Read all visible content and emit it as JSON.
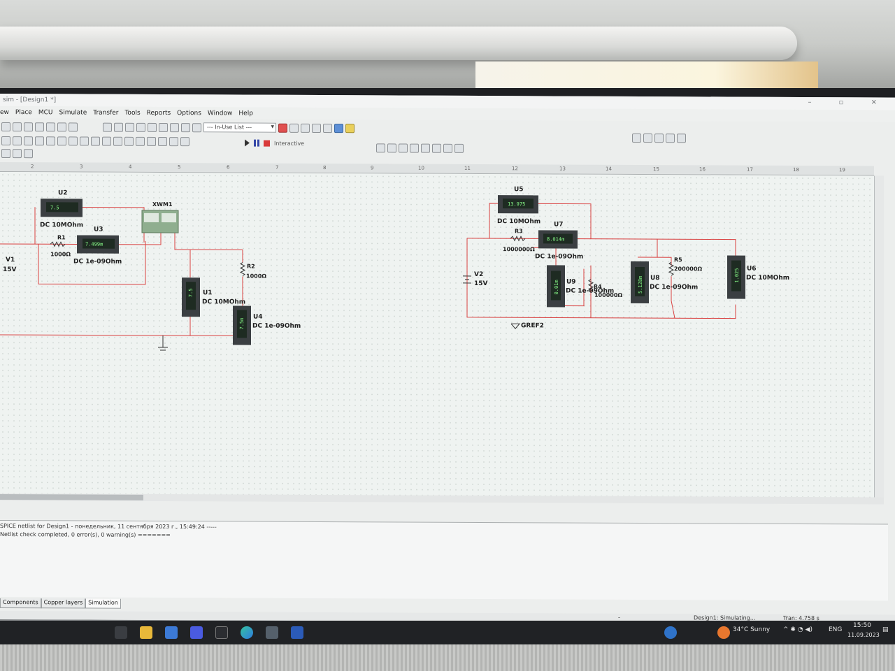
{
  "window": {
    "title": "sim - [Design1 *]",
    "controls": [
      "–",
      "▫",
      "✕"
    ]
  },
  "menu": [
    "ew",
    "Place",
    "MCU",
    "Simulate",
    "Transfer",
    "Tools",
    "Reports",
    "Options",
    "Window",
    "Help"
  ],
  "toolbar": {
    "in_use_list": "--- In-Use List ---",
    "mode": "Interactive"
  },
  "ruler": [
    "2",
    "3",
    "4",
    "5",
    "6",
    "7",
    "8",
    "9",
    "10",
    "11",
    "12",
    "13",
    "14",
    "15",
    "16",
    "17",
    "18",
    "19"
  ],
  "schematic": {
    "left": {
      "v1": {
        "name": "V1",
        "value": "15V"
      },
      "r1": {
        "name": "R1",
        "value": "1000Ω"
      },
      "r2": {
        "name": "R2",
        "value": "1000Ω"
      },
      "u2": {
        "name": "U2",
        "reading": "7.5",
        "spec": "DC  10MOhm"
      },
      "u3": {
        "name": "U3",
        "reading": "7.499m",
        "spec": "DC  1e-09Ohm"
      },
      "u1": {
        "name": "U1",
        "reading": "7.5",
        "spec": "DC  10MOhm"
      },
      "u4": {
        "name": "U4",
        "reading": "7.5m",
        "spec": "DC  1e-09Ohm"
      },
      "xwm1": {
        "name": "XWM1"
      }
    },
    "right": {
      "v2": {
        "name": "V2",
        "value": "15V"
      },
      "u5": {
        "name": "U5",
        "reading": "13.975",
        "spec": "DC  10MOhm"
      },
      "u7": {
        "name": "U7",
        "reading": "8.014m",
        "spec": "DC  1e-09Ohm"
      },
      "r3": {
        "name": "R3",
        "value": "1000000Ω"
      },
      "u9": {
        "name": "U9",
        "reading": "0.01m",
        "spec": "DC  1e-09Ohm"
      },
      "r4": {
        "name": "R4",
        "value": "100000Ω"
      },
      "u8": {
        "name": "U8",
        "reading": "5.128m",
        "spec": "DC  1e-09Ohm"
      },
      "r5": {
        "name": "R5",
        "value": "200000Ω"
      },
      "u6": {
        "name": "U6",
        "reading": "1.025",
        "spec": "DC  10MOhm"
      },
      "gnd": {
        "name": "GREF2"
      }
    }
  },
  "output": {
    "line1": "SPICE netlist for Design1 - понедельник, 11 сентября 2023 г., 15:49:24 -----",
    "line2": "Netlist check completed, 0 error(s), 0 warning(s) ======="
  },
  "tabs": [
    "Components",
    "Copper layers",
    "Simulation"
  ],
  "status": {
    "left": "-",
    "state": "Design1: Simulating...",
    "tran": "Tran: 4.758 s"
  },
  "taskbar": {
    "weather": "34°C  Sunny",
    "lang": "ENG",
    "time": "15:50",
    "date": "11.09.2023"
  },
  "colors": {
    "wire": "#d94040",
    "lcd_bg": "#1e2b22",
    "lcd_text": "#8aff8a",
    "meter_body": "#3b3f42"
  }
}
